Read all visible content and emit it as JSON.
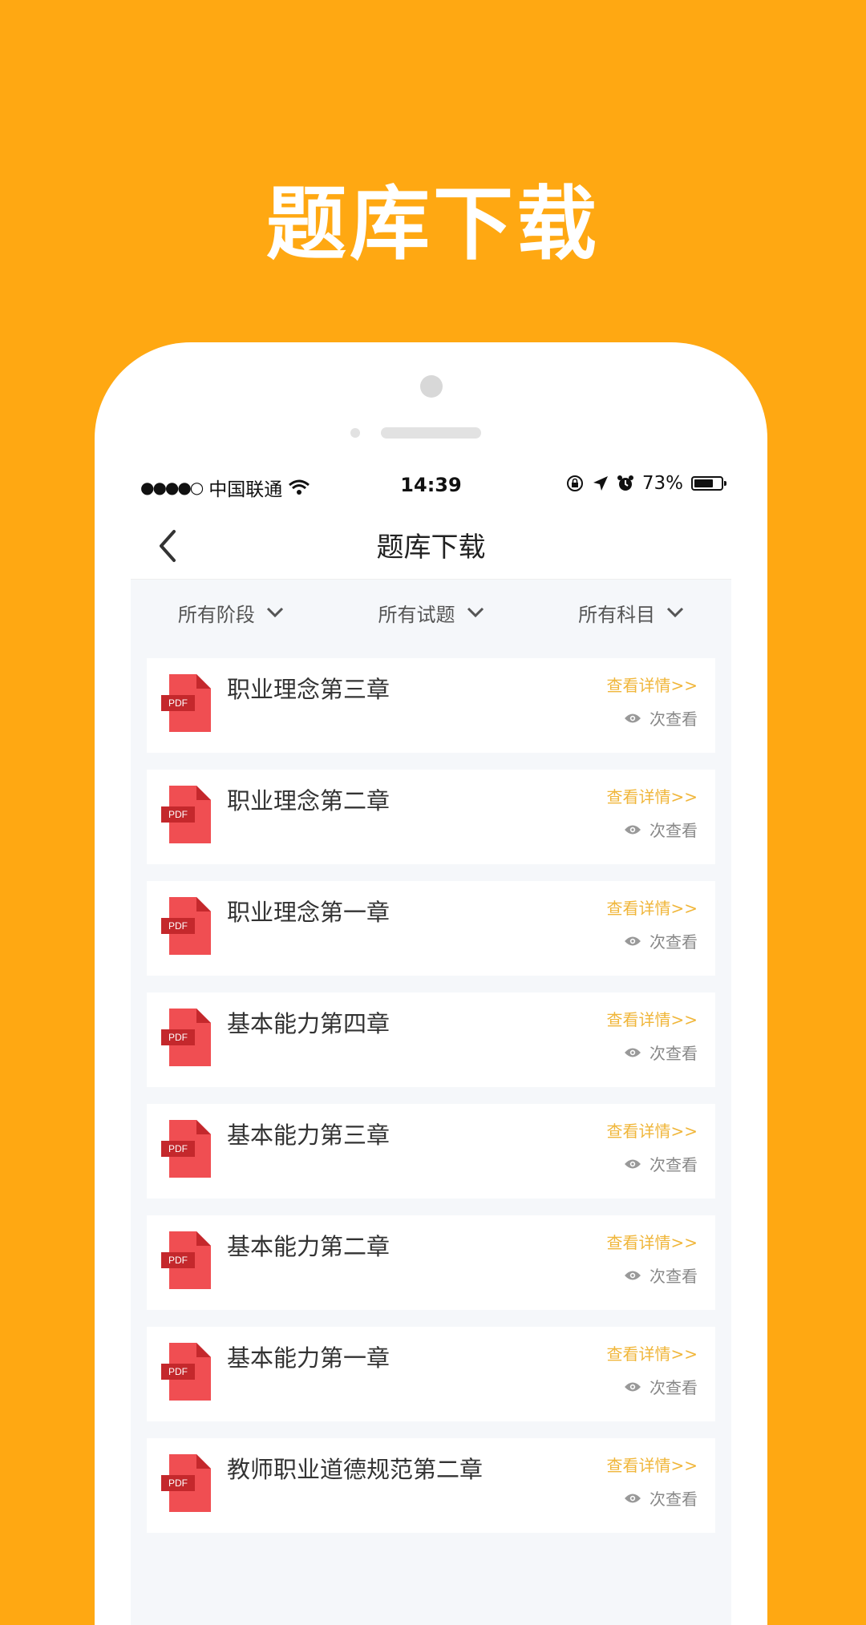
{
  "promo": {
    "title": "题库下载"
  },
  "status_bar": {
    "signal": "●●●●○",
    "carrier": "中国联通",
    "time": "14:39",
    "battery_percent": "73%",
    "battery_level": 0.73
  },
  "nav": {
    "title": "题库下载"
  },
  "filters": [
    {
      "label": "所有阶段"
    },
    {
      "label": "所有试题"
    },
    {
      "label": "所有科目"
    }
  ],
  "list": {
    "file_type": "PDF",
    "detail_label": "查看详情>>",
    "views_suffix": "次查看",
    "items": [
      {
        "title": "职业理念第三章"
      },
      {
        "title": "职业理念第二章"
      },
      {
        "title": "职业理念第一章"
      },
      {
        "title": "基本能力第四章"
      },
      {
        "title": "基本能力第三章"
      },
      {
        "title": "基本能力第二章"
      },
      {
        "title": "基本能力第一章"
      },
      {
        "title": "教师职业道德规范第二章"
      }
    ]
  },
  "colors": {
    "background": "#FFA812",
    "accent": "#F0B63A",
    "pdf_red": "#F04E52"
  }
}
